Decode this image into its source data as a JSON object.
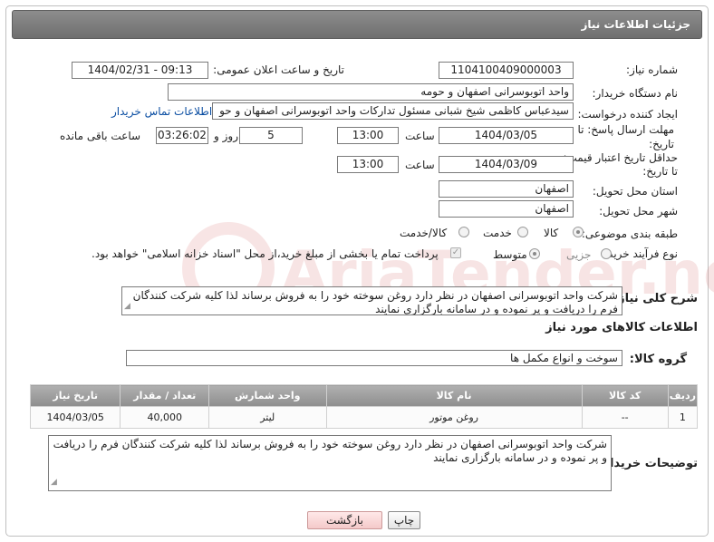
{
  "header": {
    "title": "جزئیات اطلاعات نیاز"
  },
  "fields": {
    "need_number_label": "شماره نیاز:",
    "need_number": "1104100409000003",
    "announce_label": "تاریخ و ساعت اعلان عمومی:",
    "announce_value": "1404/02/31 - 09:13",
    "buyer_org_label": "نام دستگاه خریدار:",
    "buyer_org": "واحد اتوبوسرانی اصفهان و حومه",
    "creator_label": "ایجاد کننده درخواست:",
    "creator": "سیدعباس کاظمی شیخ شبانی مسئول تدارکات  واحد اتوبوسرانی اصفهان و حو",
    "contact_link": "اطلاعات تماس خریدار",
    "deadline_label_1": "مهلت ارسال پاسخ: تا",
    "deadline_label_2": "تاریخ:",
    "deadline_date": "1404/03/05",
    "time_label": "ساعت",
    "deadline_time": "13:00",
    "days_value": "5",
    "days_label": "روز و",
    "remaining_value": "03:26:02",
    "remaining_label": "ساعت باقی مانده",
    "validity_label_1": "حداقل تاریخ اعتبار قیمت:",
    "validity_label_2": "تا تاریخ:",
    "validity_date": "1404/03/09",
    "validity_time": "13:00",
    "province_label": "استان محل تحویل:",
    "province": "اصفهان",
    "city_label": "شهر محل تحویل:",
    "city": "اصفهان",
    "category_label": "طبقه بندی موضوعی:",
    "category_options": [
      "کالا",
      "خدمت",
      "کالا/خدمت"
    ],
    "process_label": "نوع فرآیند خرید :",
    "process_options": [
      "جزیی",
      "متوسط"
    ],
    "payment_note": "پرداخت تمام یا بخشی از مبلغ خرید،از محل \"اسناد خزانه اسلامی\" خواهد بود."
  },
  "description": {
    "label": "شرح کلی نیاز:",
    "text": "شرکت واحد اتوبوسرانی اصفهان در نظر دارد روغن سوخته خود را به فروش برساند لذا کلیه شرکت کنندگان فرم را دریافت و پر نموده و در سامانه بارگزاری نمایند"
  },
  "goods": {
    "section_title": "اطلاعات کالاهای مورد نیاز",
    "group_label": "گروه کالا:",
    "group_value": "سوخت و انواع مکمل ها",
    "columns": [
      "ردیف",
      "کد کالا",
      "نام کالا",
      "واحد شمارش",
      "تعداد / مقدار",
      "تاریخ نیاز"
    ],
    "rows": [
      [
        "1",
        "--",
        "روغن موتور",
        "لیتر",
        "40,000",
        "1404/03/05"
      ]
    ]
  },
  "buyer_notes": {
    "label": "توضیحات خریدار:",
    "text": "شرکت واحد اتوبوسرانی اصفهان در نظر دارد روغن سوخته خود را به فروش برساند لذا کلیه شرکت کنندگان فرم را دریافت و پر نموده و در سامانه بارگزاری نمایند"
  },
  "buttons": {
    "print": "چاپ",
    "back": "بازگشت"
  },
  "watermark": {
    "text": "AriaTender.net"
  },
  "colors": {
    "header": "#7f7f7f",
    "link": "#0b4ea2",
    "watermark": "#e6b8b8"
  }
}
